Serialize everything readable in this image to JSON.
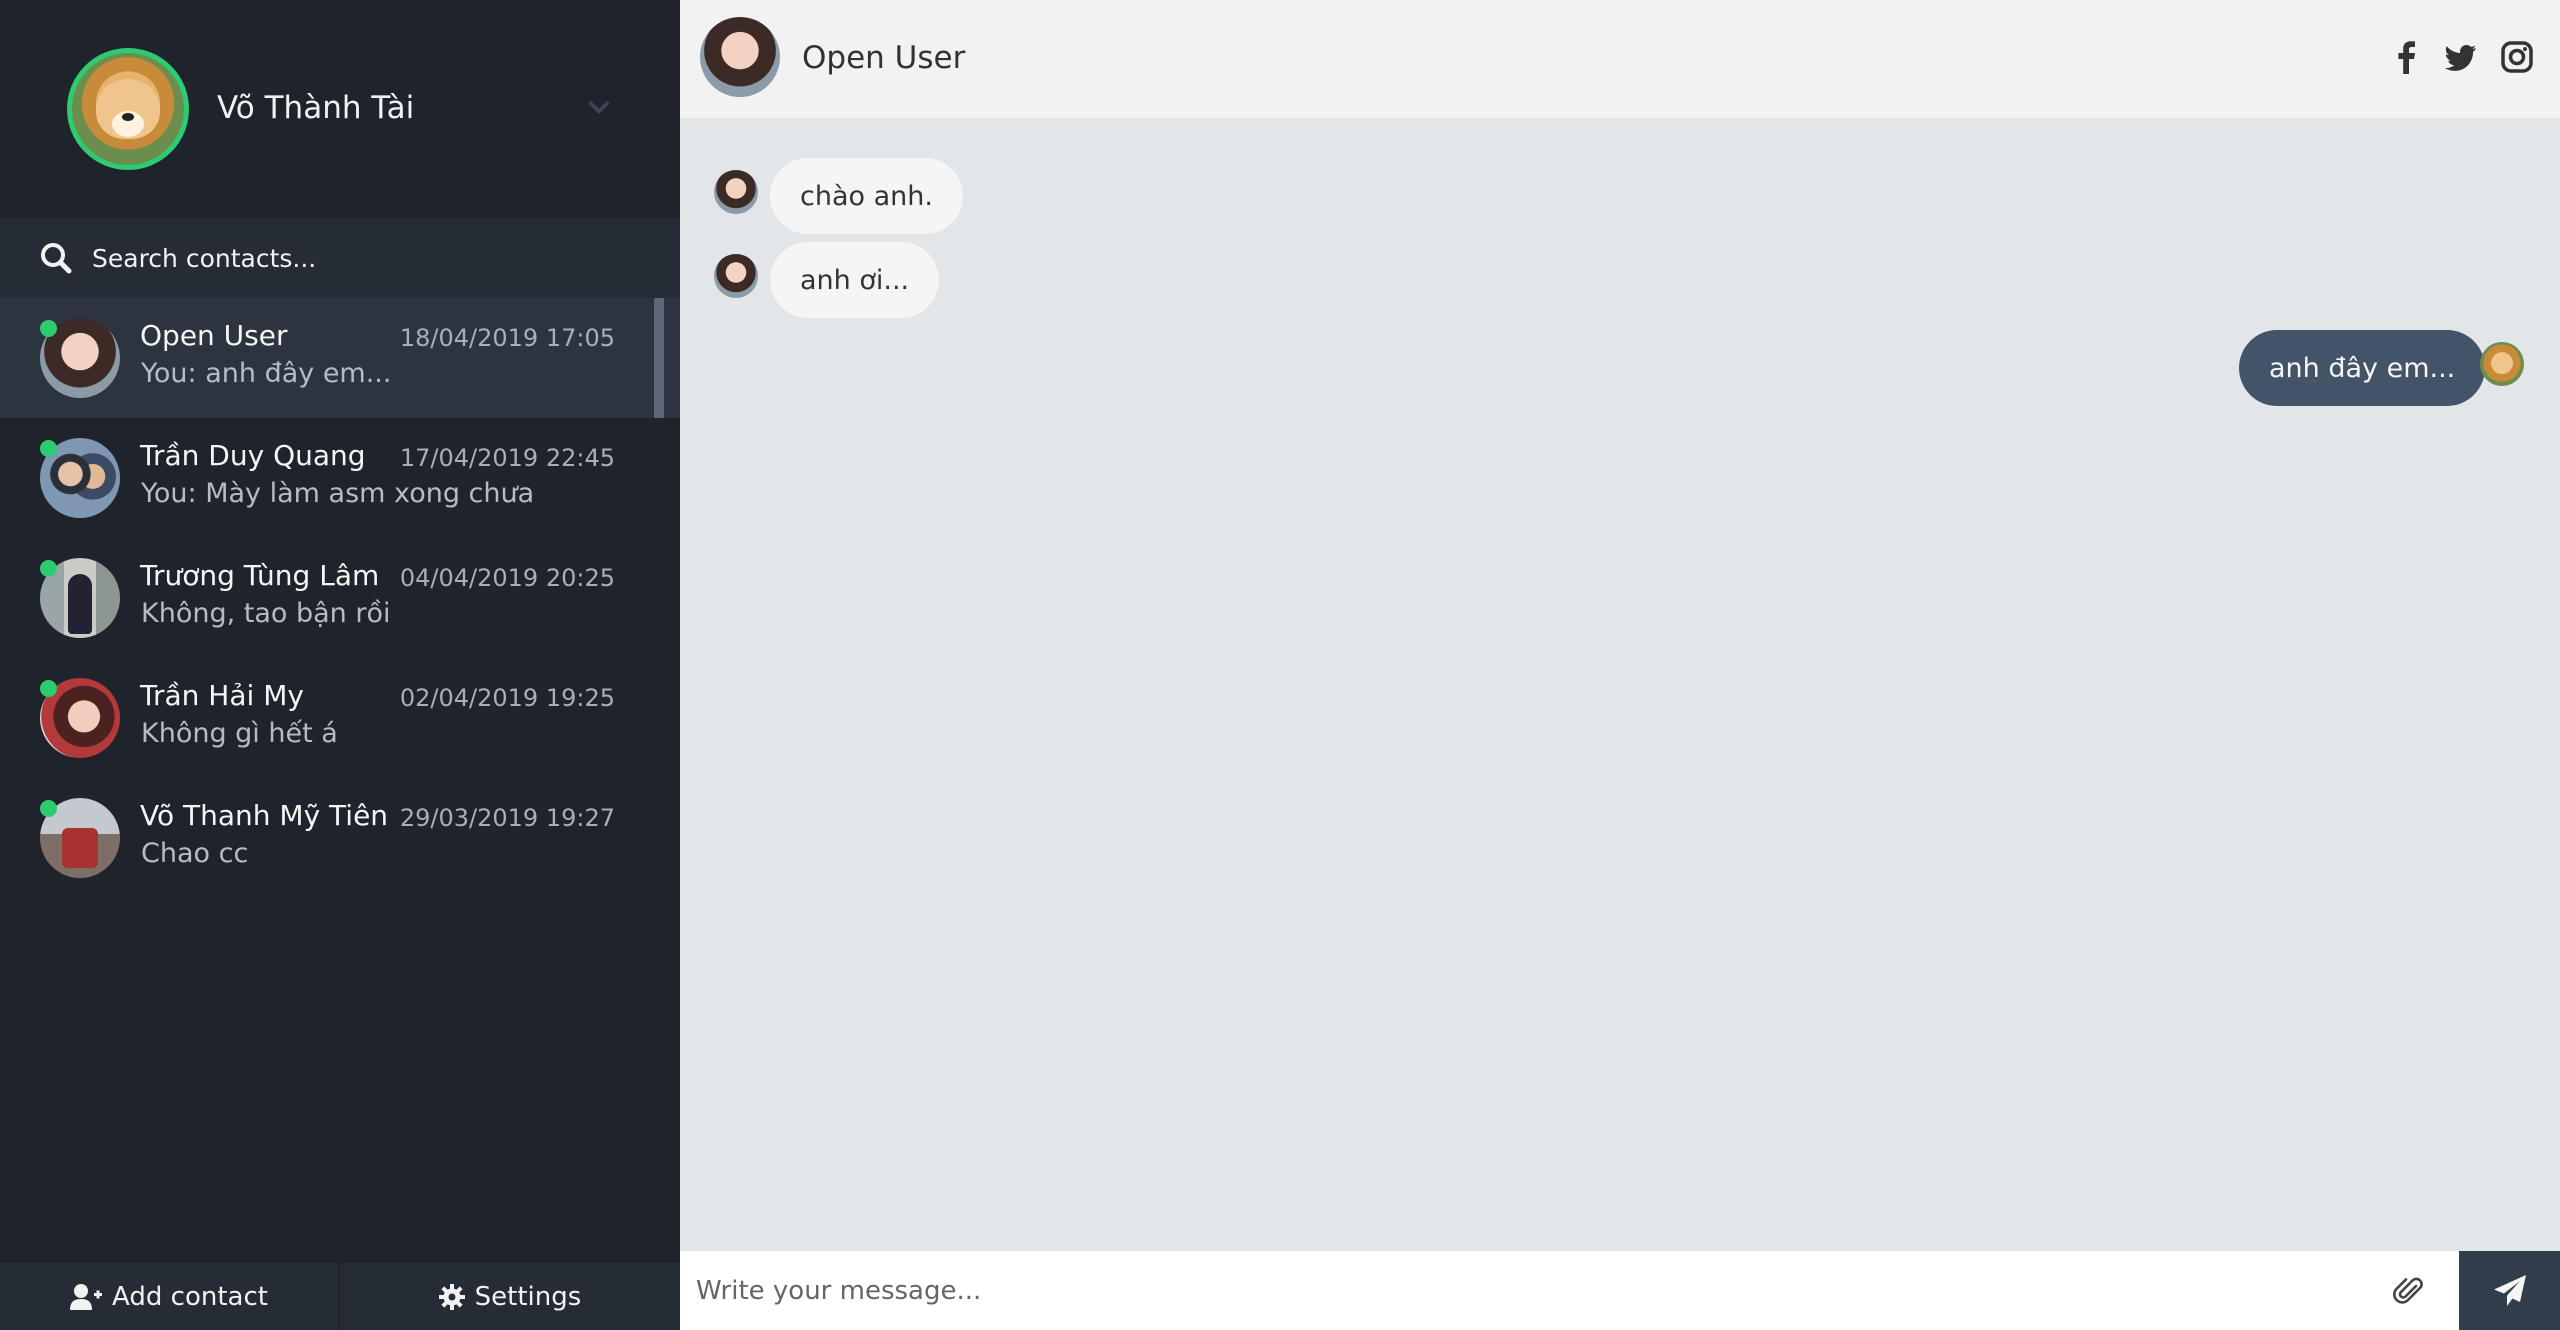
{
  "profile": {
    "name": "Võ Thành Tài"
  },
  "search": {
    "placeholder": "Search contacts..."
  },
  "contacts": [
    {
      "name": "Open User",
      "time": "18/04/2019 17:05",
      "preview": "You: anh đây em...",
      "online": true,
      "active": true
    },
    {
      "name": "Trần Duy Quang",
      "time": "17/04/2019 22:45",
      "preview": "You: Mày làm asm xong chưa",
      "online": true,
      "active": false
    },
    {
      "name": "Trương Tùng Lâm",
      "time": "04/04/2019 20:25",
      "preview": "Không, tao bận rồi",
      "online": true,
      "active": false
    },
    {
      "name": "Trần Hải My",
      "time": "02/04/2019 19:25",
      "preview": "Không gì hết á",
      "online": true,
      "active": false
    },
    {
      "name": "Võ Thanh Mỹ Tiên",
      "time": "29/03/2019 19:27",
      "preview": "Chao cc",
      "online": true,
      "active": false
    }
  ],
  "sidebar_bottom": {
    "add_contact": "Add contact",
    "settings": "Settings"
  },
  "chat": {
    "title": "Open User",
    "social_icons": [
      "facebook-icon",
      "twitter-icon",
      "instagram-icon"
    ],
    "messages": [
      {
        "direction": "in",
        "text": "chào anh."
      },
      {
        "direction": "in",
        "text": "anh ơi..."
      },
      {
        "direction": "out",
        "text": "anh đây em..."
      }
    ],
    "composer_placeholder": "Write your message..."
  },
  "colors": {
    "sidebar_bg": "#1f242c",
    "online": "#2ecc71",
    "outgoing_bubble": "#435368",
    "incoming_bubble": "#f5f5f5",
    "send_button": "#323d4c"
  }
}
